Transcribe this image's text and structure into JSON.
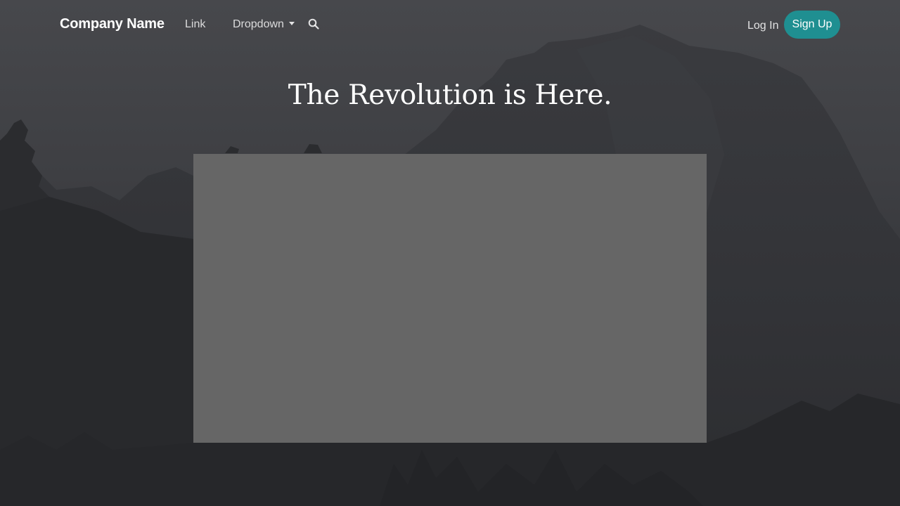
{
  "navbar": {
    "brand": "Company Name",
    "link_label": "Link",
    "dropdown_label": "Dropdown",
    "search_icon": "search-icon",
    "login_label": "Log In",
    "signup_label": "Sign Up"
  },
  "hero": {
    "headline": "The Revolution is Here."
  },
  "colors": {
    "accent": "#1f8f91",
    "media_placeholder": "#666666",
    "text": "#ffffff"
  }
}
